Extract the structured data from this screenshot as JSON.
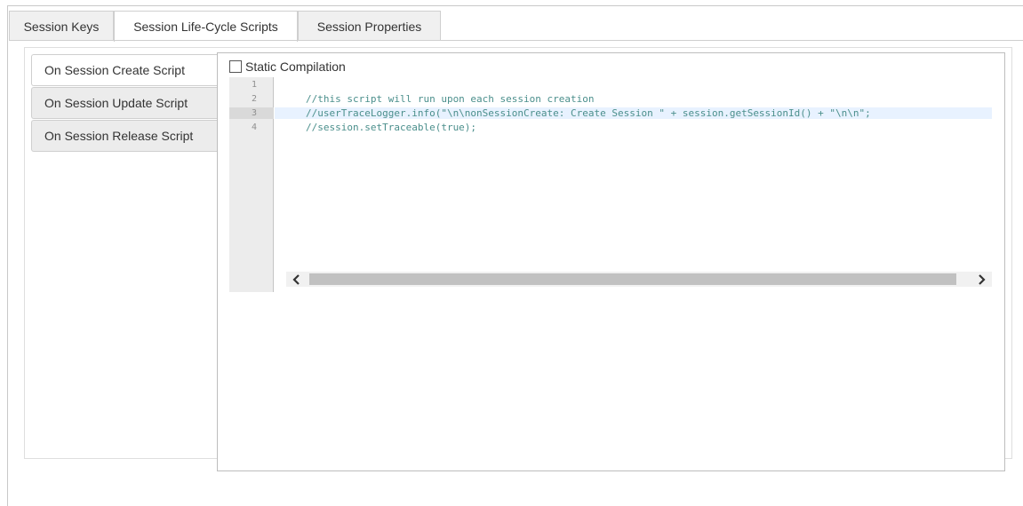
{
  "top_tabs": [
    {
      "label": "Session Keys",
      "active": false
    },
    {
      "label": "Session Life-Cycle Scripts",
      "active": true
    },
    {
      "label": "Session Properties",
      "active": false
    }
  ],
  "side_tabs": [
    {
      "label": "On Session Create Script",
      "active": true
    },
    {
      "label": "On Session Update Script",
      "active": false
    },
    {
      "label": "On Session Release Script",
      "active": false
    }
  ],
  "static_compilation": {
    "label": "Static Compilation",
    "checked": false
  },
  "editor": {
    "line_numbers": [
      "1",
      "2",
      "3",
      "4"
    ],
    "lines": [
      "",
      "//this script will run upon each session creation",
      "//userTraceLogger.info(\"\\n\\nonSessionCreate: Create Session \" + session.getSessionId() + \"\\n\\n\";",
      "//session.setTraceable(true);"
    ],
    "highlighted_line": 3,
    "code_color": "#4b8f8c"
  },
  "scrollbar": {
    "left_icon": "chevron-left-icon",
    "right_icon": "chevron-right-icon"
  }
}
